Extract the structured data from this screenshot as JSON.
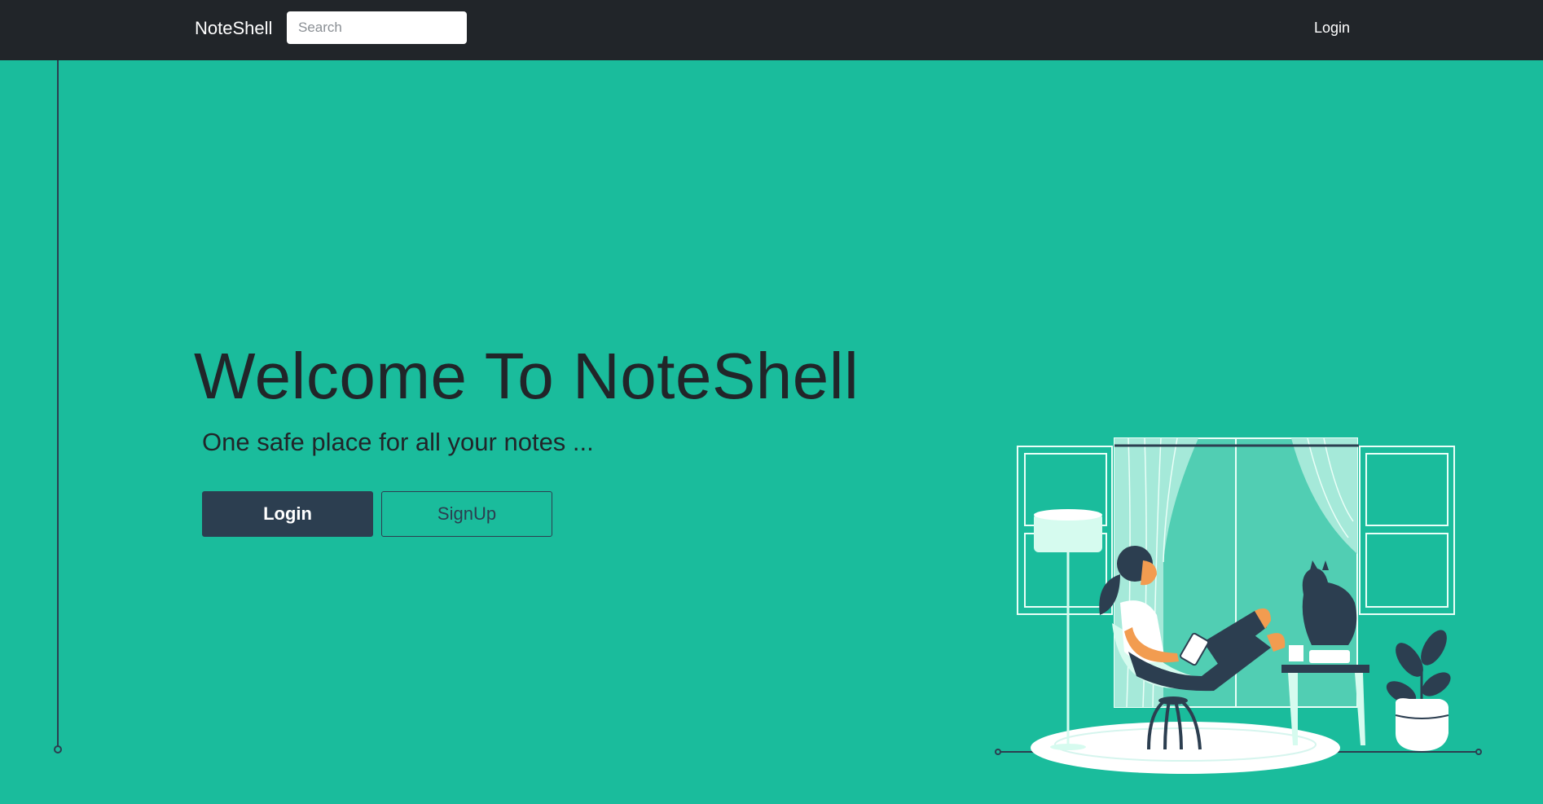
{
  "navbar": {
    "brand": "NoteShell",
    "search_placeholder": "Search",
    "login_link": "Login"
  },
  "hero": {
    "title": "Welcome To NoteShell",
    "subtitle": "One safe place for all your notes ...",
    "login_button": "Login",
    "signup_button": "SignUp"
  },
  "colors": {
    "background": "#1abc9c",
    "navbar": "#212529",
    "primary_button": "#2c3e50",
    "text_dark": "#212529"
  },
  "icons": [
    "relaxing-woman-illustration"
  ]
}
